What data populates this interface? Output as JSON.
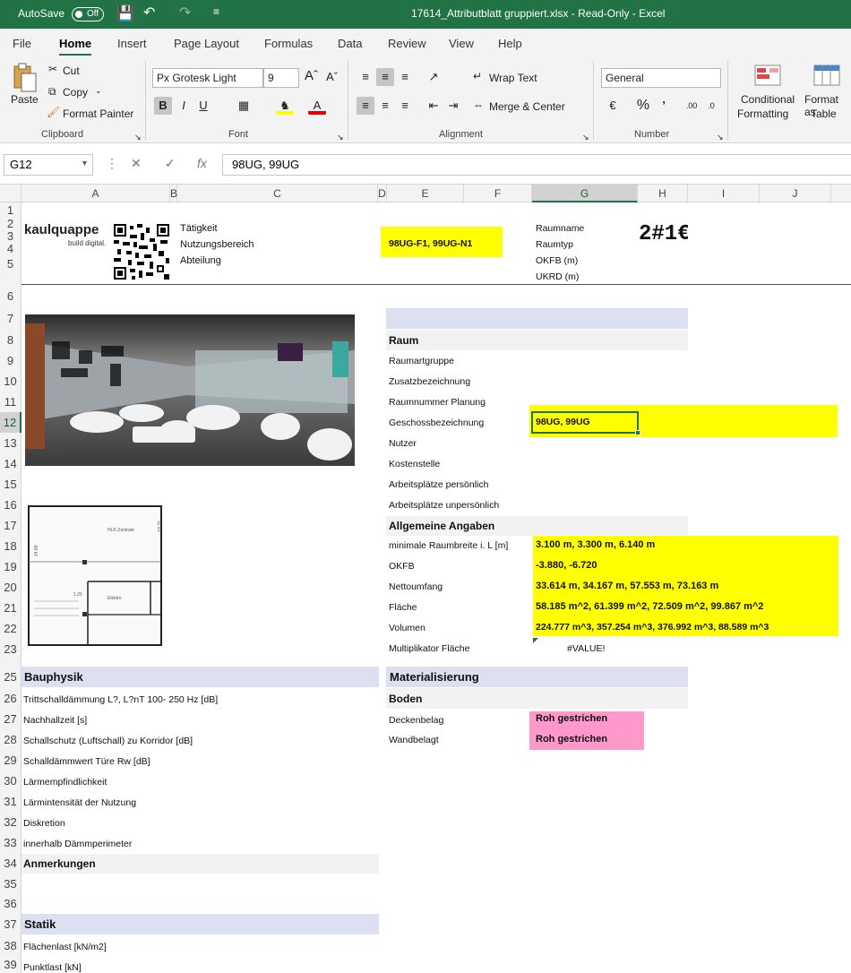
{
  "titlebar": {
    "autosave_label": "AutoSave",
    "autosave_state": "Off",
    "title": "17614_Attributblatt gruppiert.xlsx  -  Read-Only  -  Excel"
  },
  "menu": [
    "File",
    "Home",
    "Insert",
    "Page Layout",
    "Formulas",
    "Data",
    "Review",
    "View",
    "Help"
  ],
  "ribbon": {
    "paste": "Paste",
    "cut": "Cut",
    "copy": "Copy",
    "format_painter": "Format Painter",
    "clipboard": "Clipboard",
    "font_name": "Px Grotesk Light",
    "font_size": "9",
    "font": "Font",
    "wrap_text": "Wrap Text",
    "merge_center": "Merge & Center",
    "alignment": "Alignment",
    "number_format": "General",
    "number": "Number",
    "conditional_1": "Conditional",
    "conditional_2": "Formatting",
    "format_as_1": "Format as",
    "format_as_2": "Table"
  },
  "formula_bar": {
    "name_box": "G12",
    "formula": "98UG, 99UG"
  },
  "columns": [
    "A",
    "B",
    "C",
    "D",
    "E",
    "F",
    "G",
    "H",
    "I",
    "J"
  ],
  "rows": [
    "1",
    "2",
    "3",
    "4",
    "5",
    "6",
    "7",
    "8",
    "9",
    "10",
    "11",
    "12",
    "13",
    "14",
    "15",
    "16",
    "17",
    "18",
    "19",
    "20",
    "21",
    "22",
    "23",
    "25",
    "26",
    "27",
    "28",
    "29",
    "30",
    "31",
    "32",
    "33",
    "34",
    "35",
    "36",
    "37",
    "38",
    "39"
  ],
  "sheet": {
    "logo_main": "kaulquappe",
    "logo_sub": "build digital.",
    "taetigkeit": "Tätigkeit",
    "nutzungsbereich": "Nutzungsbereich",
    "abteilung": "Abteilung",
    "header_code": "98UG-F1, 99UG-N1",
    "raumname": "Raumname",
    "raumtyp": "Raumtyp",
    "okfb_m": "OKFB (m)",
    "ukrd_m": "UKRD (m)",
    "room_number": "2#1€",
    "raum": "Raum",
    "raumartgruppe": "Raumartgruppe",
    "zusatzbezeichnung": "Zusatzbezeichnung",
    "raumnummer_planung": "Raumnummer Planung",
    "geschossbezeichnung": "Geschossbezeichnung",
    "geschoss_value": "98UG, 99UG",
    "nutzer": "Nutzer",
    "kostenstelle": "Kostenstelle",
    "arbeitsplaetze_p": "Arbeitsplätze persönlich",
    "arbeitsplaetze_u": "Arbeitsplätze unpersönlich",
    "allgemeine": "Allgemeine Angaben",
    "min_raumbreite": "minimale Raumbreite i. L [m]",
    "min_raumbreite_val": "3.100 m, 3.300 m, 6.140 m",
    "okfb": "OKFB",
    "okfb_val": "-3.880, -6.720",
    "nettoumfang": "Nettoumfang",
    "nettoumfang_val": "33.614 m, 34.167 m, 57.553 m, 73.163 m",
    "flaeche": "Fläche",
    "flaeche_val": "58.185 m^2, 61.399 m^2, 72.509 m^2, 99.867 m^2",
    "volumen": "Volumen",
    "volumen_val": "224.777 m^3, 357.254 m^3, 376.992 m^3, 88.589 m^3",
    "multiplikator": "Multiplikator Fläche",
    "multiplikator_val": "#VALUE!",
    "bauphysik": "Bauphysik",
    "trittschall": "Trittschalldämmung L?, L?nT 100- 250 Hz [dB]",
    "nachhallzeit": "Nachhallzeit [s]",
    "schallschutz": "Schallschutz (Luftschall) zu Korridor [dB]",
    "schalldaemmwert": "Schalldämmwert Türe Rw [dB]",
    "laermempfindlichkeit": "Lärmempfindlichkeit",
    "laermintensitaet": "Lärmintensität der Nutzung",
    "diskretion": "Diskretion",
    "daemmperimeter": "innerhalb Dämmperimeter",
    "anmerkungen": "Anmerkungen",
    "statik": "Statik",
    "flaechenlast": "Flächenlast [kN/m2]",
    "punktlast": "Punktlast [kN]",
    "materialisierung": "Materialisierung",
    "boden": "Boden",
    "deckenbelag": "Deckenbelag",
    "deckenbelag_val": "Roh gestrichen",
    "wandbelag": "Wandbelagt",
    "wandbelag_val": "Roh gestrichen"
  },
  "plan_labels": {
    "room1": "HLK-Zentrale",
    "room2": "Elektro",
    "dim1": "11.53",
    "dim2": "14.80",
    "dim3": "1.25"
  },
  "colors": {
    "excel_green": "#217346",
    "highlight_yellow": "#ffff00",
    "highlight_pink": "#ff99cc",
    "section_band": "#dce0f0"
  }
}
